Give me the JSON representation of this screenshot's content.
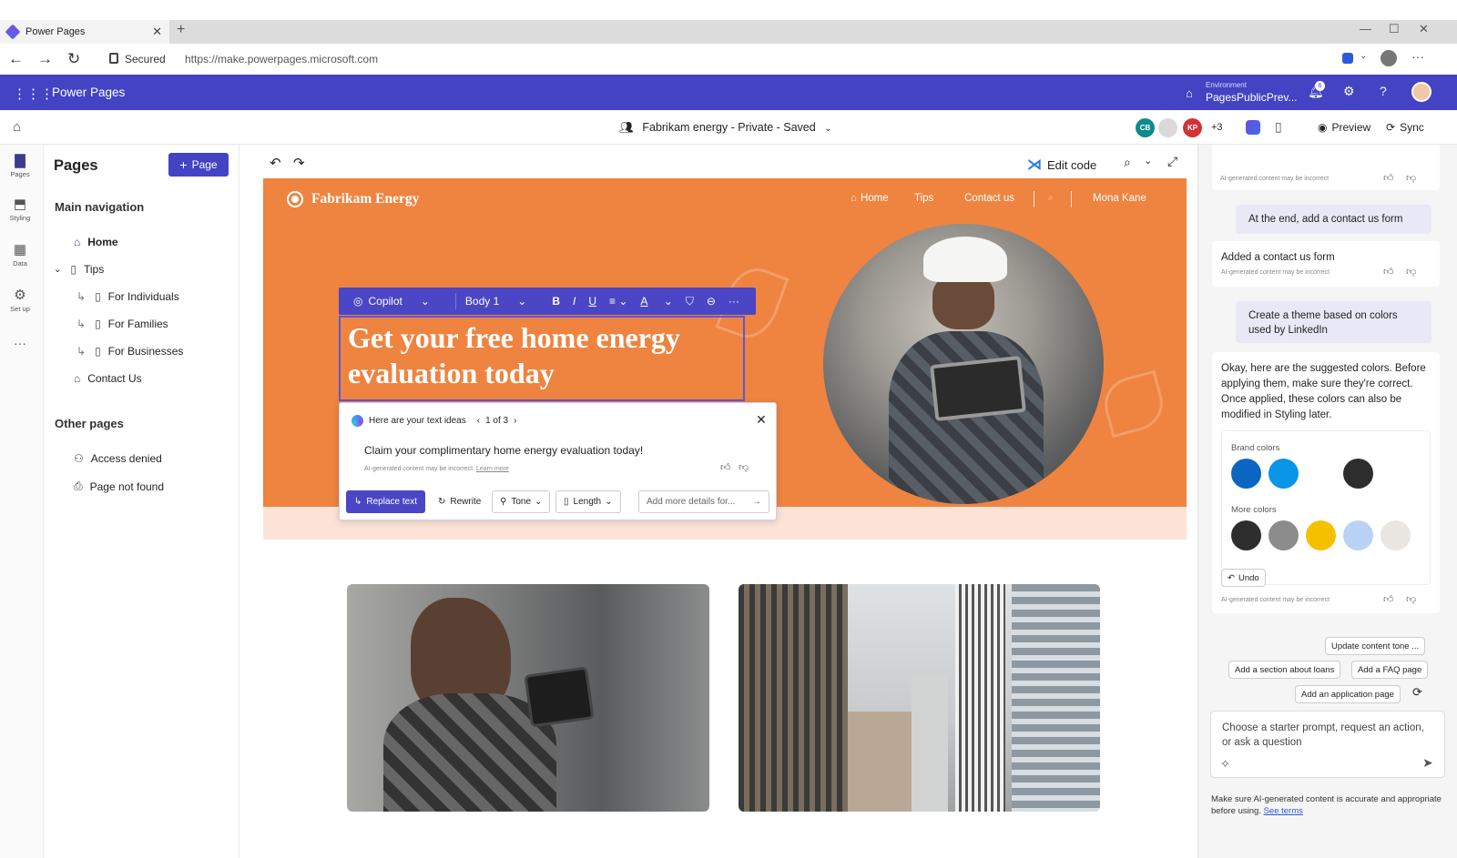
{
  "browser": {
    "tab_title": "Power Pages",
    "secured": "Secured",
    "url": "https://make.powerpages.microsoft.com"
  },
  "appbar": {
    "app_name": "Power Pages",
    "environment_label": "Environment",
    "environment_value": "PagesPublicPrev...",
    "notification_count": "6"
  },
  "commandbar": {
    "site_title": "Fabrikam energy - Private - Saved",
    "avatars": [
      {
        "initials": "CB",
        "color": "#0f8a8a"
      },
      {
        "initials": "",
        "color": "#d9d9d9"
      },
      {
        "initials": "KP",
        "color": "#d13438"
      }
    ],
    "extra_count": "+3",
    "preview": "Preview",
    "sync": "Sync"
  },
  "rail": {
    "items": [
      {
        "label": "Pages",
        "icon": "page-icon"
      },
      {
        "label": "Styling",
        "icon": "paintbrush-icon"
      },
      {
        "label": "Data",
        "icon": "table-icon"
      },
      {
        "label": "Set up",
        "icon": "setup-icon"
      },
      {
        "label": "",
        "icon": "more-icon"
      }
    ]
  },
  "pages_panel": {
    "title": "Pages",
    "add_button": "Page",
    "main_nav_title": "Main navigation",
    "main_nav": [
      {
        "label": "Home",
        "level": 0,
        "icon": "home-icon"
      },
      {
        "label": "Tips",
        "level": 0,
        "icon": "page-icon"
      },
      {
        "label": "For Individuals",
        "level": 1,
        "icon": "page-icon"
      },
      {
        "label": "For Families",
        "level": 1,
        "icon": "page-icon"
      },
      {
        "label": "For Businesses",
        "level": 1,
        "icon": "page-icon"
      },
      {
        "label": "Contact Us",
        "level": 0,
        "icon": "home-icon"
      }
    ],
    "other_title": "Other pages",
    "other_pages": [
      {
        "label": "Access denied",
        "icon": "person-lock-icon"
      },
      {
        "label": "Page not found",
        "icon": "page-search-icon"
      }
    ]
  },
  "canvas": {
    "edit_code": "Edit code",
    "site_logo": "Fabrikam Energy",
    "site_nav": [
      "Home",
      "Tips",
      "Contact us",
      "Mona Kane"
    ],
    "format_toolbar": {
      "copilot": "Copilot",
      "style": "Body 1",
      "bold": "B",
      "italic": "I",
      "underline": "U",
      "font_color": "A",
      "more": "···"
    },
    "headline_line1": "Get your free home energy",
    "headline_line2": "evaluation today",
    "idea_card": {
      "title": "Here are your text ideas",
      "pager": "1 of 3",
      "suggestion": "Claim your complimentary home energy evaluation today!",
      "disclaimer": "AI-generated content may be incorrect.",
      "learn_more": "Learn more",
      "replace": "Replace text",
      "rewrite": "Rewrite",
      "tone": "Tone",
      "length": "Length",
      "details_placeholder": "Add more details for..."
    }
  },
  "copilot": {
    "disclaimer": "AI-generated content may be incorrect",
    "messages": {
      "user1": "At the end, add a contact us form",
      "bot1": "Added a contact us form",
      "user2": "Create a theme based on colors used by LinkedIn",
      "bot2": "Okay, here are the suggested colors. Before applying them, make sure they're correct. Once applied, these colors can also be modified in Styling later."
    },
    "brand_colors_label": "Brand colors",
    "brand_colors": [
      "#0a66c2",
      "#0a95e6",
      "#2d2d2d"
    ],
    "more_colors_label": "More colors",
    "more_colors": [
      "#2d2d2d",
      "#8c8c8c",
      "#f5c000",
      "#b9d2f5",
      "#e9e6e1"
    ],
    "undo": "Undo",
    "chips": [
      "Update content tone ...",
      "Add a section about loans",
      "Add a FAQ page",
      "Add an application page"
    ],
    "input_placeholder": "Choose a starter prompt, request an action, or ask a question",
    "footnote": "Make sure AI-generated content is accurate and appropriate before using.",
    "see_terms": "See terms"
  }
}
